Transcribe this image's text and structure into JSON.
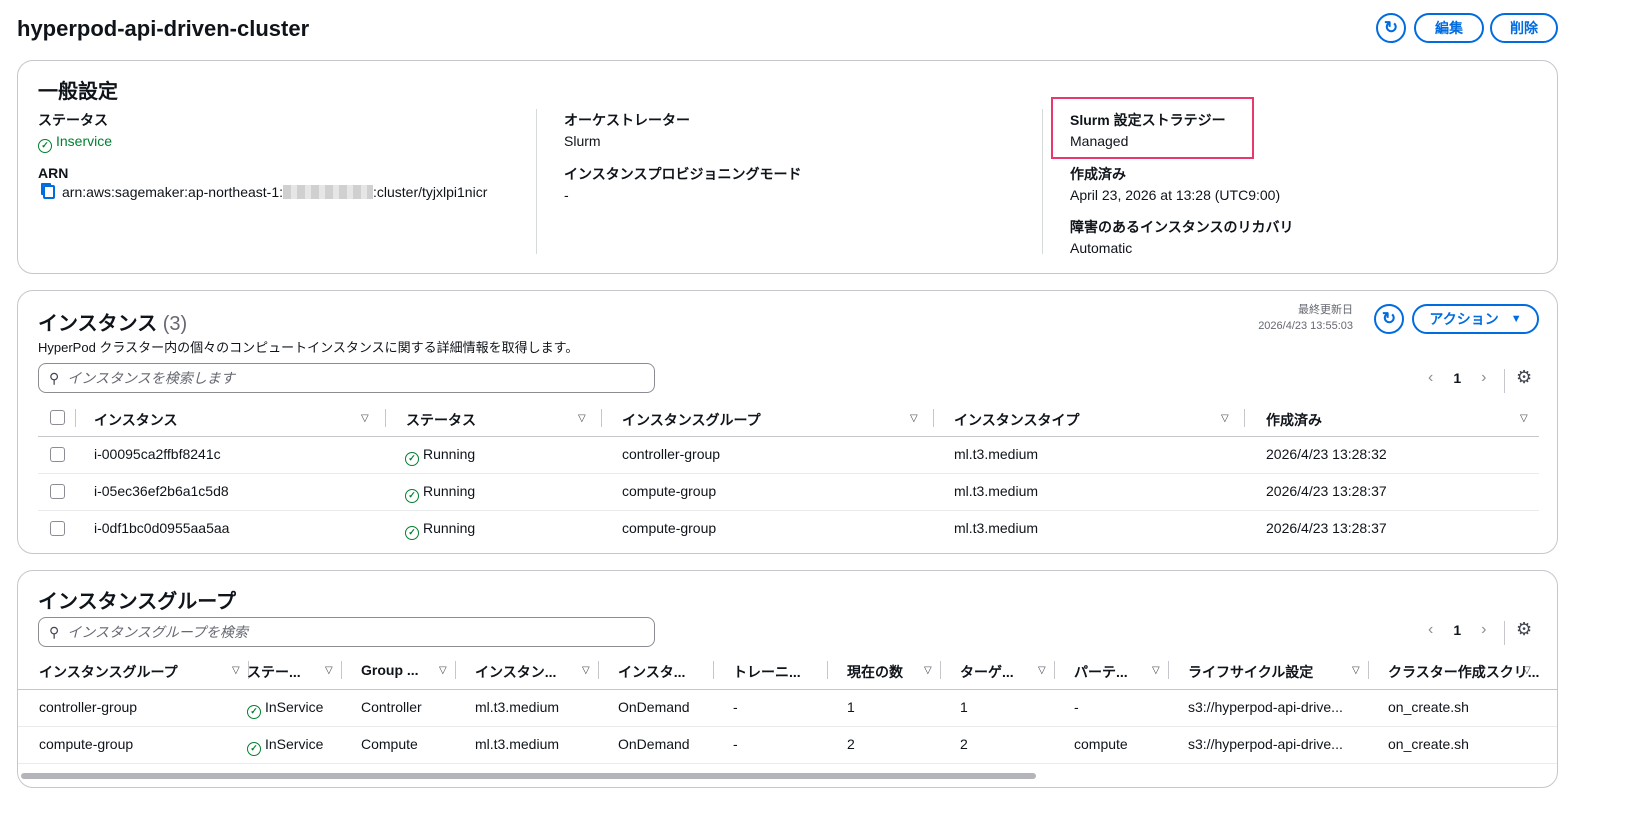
{
  "header": {
    "title": "hyperpod-api-driven-cluster",
    "edit": "編集",
    "delete": "削除"
  },
  "general": {
    "title": "一般設定",
    "status_label": "ステータス",
    "status_value": "Inservice",
    "arn_label": "ARN",
    "arn_prefix": "arn:aws:sagemaker:ap-northeast-1:",
    "arn_suffix": ":cluster/tyjxlpi1nicr",
    "orchestrator_label": "オーケストレーター",
    "orchestrator_value": "Slurm",
    "provisioning_label": "インスタンスプロビジョニングモード",
    "provisioning_value": "-",
    "slurm_label": "Slurm 設定ストラテジー",
    "slurm_value": "Managed",
    "created_label": "作成済み",
    "created_value": "April 23, 2026 at 13:28 (UTC9:00)",
    "recovery_label": "障害のあるインスタンスのリカバリ",
    "recovery_value": "Automatic"
  },
  "instances": {
    "title": "インスタンス",
    "count": "(3)",
    "description": "HyperPod クラスター内の個々のコンピュートインスタンスに関する詳細情報を取得します。",
    "last_updated_label": "最終更新日",
    "last_updated": "2026/4/23 13:55:03",
    "actions": "アクション",
    "search_placeholder": "インスタンスを検索します",
    "page": "1",
    "columns": [
      "インスタンス",
      "ステータス",
      "インスタンスグループ",
      "インスタンスタイプ",
      "作成済み"
    ],
    "rows": [
      {
        "id": "i-00095ca2ffbf8241c",
        "status": "Running",
        "group": "controller-group",
        "type": "ml.t3.medium",
        "created": "2026/4/23 13:28:32"
      },
      {
        "id": "i-05ec36ef2b6a1c5d8",
        "status": "Running",
        "group": "compute-group",
        "type": "ml.t3.medium",
        "created": "2026/4/23 13:28:37"
      },
      {
        "id": "i-0df1bc0d0955aa5aa",
        "status": "Running",
        "group": "compute-group",
        "type": "ml.t3.medium",
        "created": "2026/4/23 13:28:37"
      }
    ]
  },
  "groups": {
    "title": "インスタンスグループ",
    "search_placeholder": "インスタンスグループを検索",
    "page": "1",
    "columns": [
      "インスタンスグループ",
      "ステー...",
      "Group ...",
      "インスタン...",
      "インスタ...",
      "トレーニ...",
      "現在の数",
      "ターゲ...",
      "パーテ...",
      "ライフサイクル設定",
      "クラスター作成スクリ..."
    ],
    "rows": [
      [
        "controller-group",
        "InService",
        "Controller",
        "ml.t3.medium",
        "OnDemand",
        "-",
        "1",
        "1",
        "-",
        "s3://hyperpod-api-drive...",
        "on_create.sh"
      ],
      [
        "compute-group",
        "InService",
        "Compute",
        "ml.t3.medium",
        "OnDemand",
        "-",
        "2",
        "2",
        "compute",
        "s3://hyperpod-api-drive...",
        "on_create.sh"
      ]
    ]
  }
}
